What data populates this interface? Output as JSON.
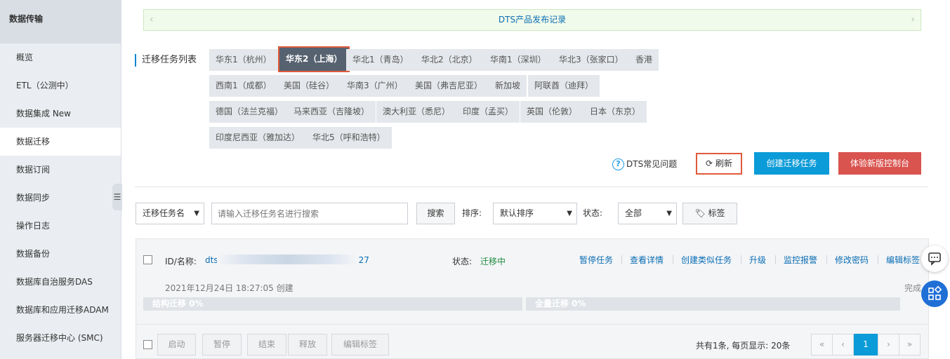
{
  "sidebar": {
    "title": "数据传输",
    "items": [
      {
        "label": "概览"
      },
      {
        "label": "ETL（公测中）"
      },
      {
        "label": "数据集成  New"
      },
      {
        "label": "数据迁移"
      },
      {
        "label": "数据订阅"
      },
      {
        "label": "数据同步"
      },
      {
        "label": "操作日志"
      },
      {
        "label": "数据备份"
      },
      {
        "label": "数据库自治服务DAS"
      },
      {
        "label": "数据库和应用迁移ADAM"
      },
      {
        "label": "服务器迁移中心 (SMC)"
      }
    ],
    "active_index": 3
  },
  "notice": {
    "text": "DTS产品发布记录"
  },
  "regions": {
    "label": "迁移任务列表",
    "items": [
      "华东1（杭州）",
      "华东2（上海）",
      "华北1（青岛）",
      "华北2（北京）",
      "华南1（深圳）",
      "华北3（张家口）",
      "香港",
      "西南1（成都）",
      "美国（硅谷）",
      "华南3（广州）",
      "美国（弗吉尼亚）",
      "新加坡",
      "阿联酋（迪拜）",
      "德国（法兰克福）",
      "马来西亚（吉隆坡）",
      "澳大利亚（悉尼）",
      "印度（孟买）",
      "英国（伦敦）",
      "日本（东京）",
      "印度尼西亚（雅加达）",
      "华北5（呼和浩特）"
    ],
    "active": "华东2（上海）"
  },
  "toolbar": {
    "faq": "DTS常见问题",
    "refresh": "刷新",
    "create": "创建迁移任务",
    "new_console": "体验新版控制台"
  },
  "filters": {
    "field_select": "迁移任务名",
    "search_placeholder": "请输入迁移任务名进行搜索",
    "search_button": "搜索",
    "sort_label": "排序:",
    "sort_value": "默认排序",
    "status_label": "状态:",
    "status_value": "全部",
    "tag_button": "标签"
  },
  "task": {
    "id_label": "ID/名称:",
    "id_prefix": "dts",
    "id_suffix": "27",
    "status_label": "状态:",
    "status_value": "迁移中",
    "actions": [
      "暂停任务",
      "查看详情",
      "创建类似任务",
      "升级",
      "监控报警",
      "修改密码",
      "编辑标签"
    ],
    "created": "2021年12月24日 18:27:05  创建",
    "done_label": "完成",
    "struct_bar": "结构迁移 0%",
    "full_bar": "全量迁移 0%",
    "status_color": "#1f8b3e"
  },
  "bottom": {
    "buttons": [
      "启动",
      "暂停",
      "结束",
      "释放",
      "编辑标签"
    ],
    "page_info": "共有1条,  每页显示: 20条",
    "pager": [
      "«",
      "‹",
      "1",
      "›",
      "»"
    ],
    "current_page": "1"
  },
  "colors": {
    "accent": "#0b9bd8",
    "danger": "#d9534f",
    "highlight": "#e05a3c"
  }
}
